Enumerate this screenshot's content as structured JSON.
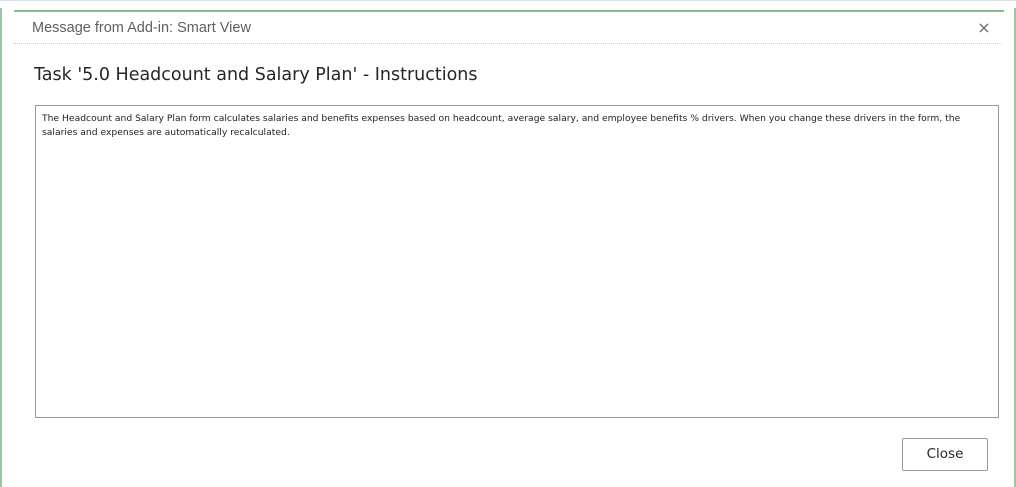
{
  "dialog": {
    "title": "Message from Add-in: Smart View",
    "close_icon_glyph": "×",
    "heading": "Task '5.0 Headcount and Salary Plan' - Instructions",
    "instructions": "The Headcount and Salary Plan form calculates salaries and benefits expenses based on headcount, average salary, and employee benefits % drivers. When you change these drivers in the form, the salaries and expenses are automatically recalculated.",
    "close_button_label": "Close"
  },
  "colors": {
    "window_edge": "#9cc7a2",
    "dialog_accent": "#86bf8c",
    "border": "#9a9a9a"
  }
}
